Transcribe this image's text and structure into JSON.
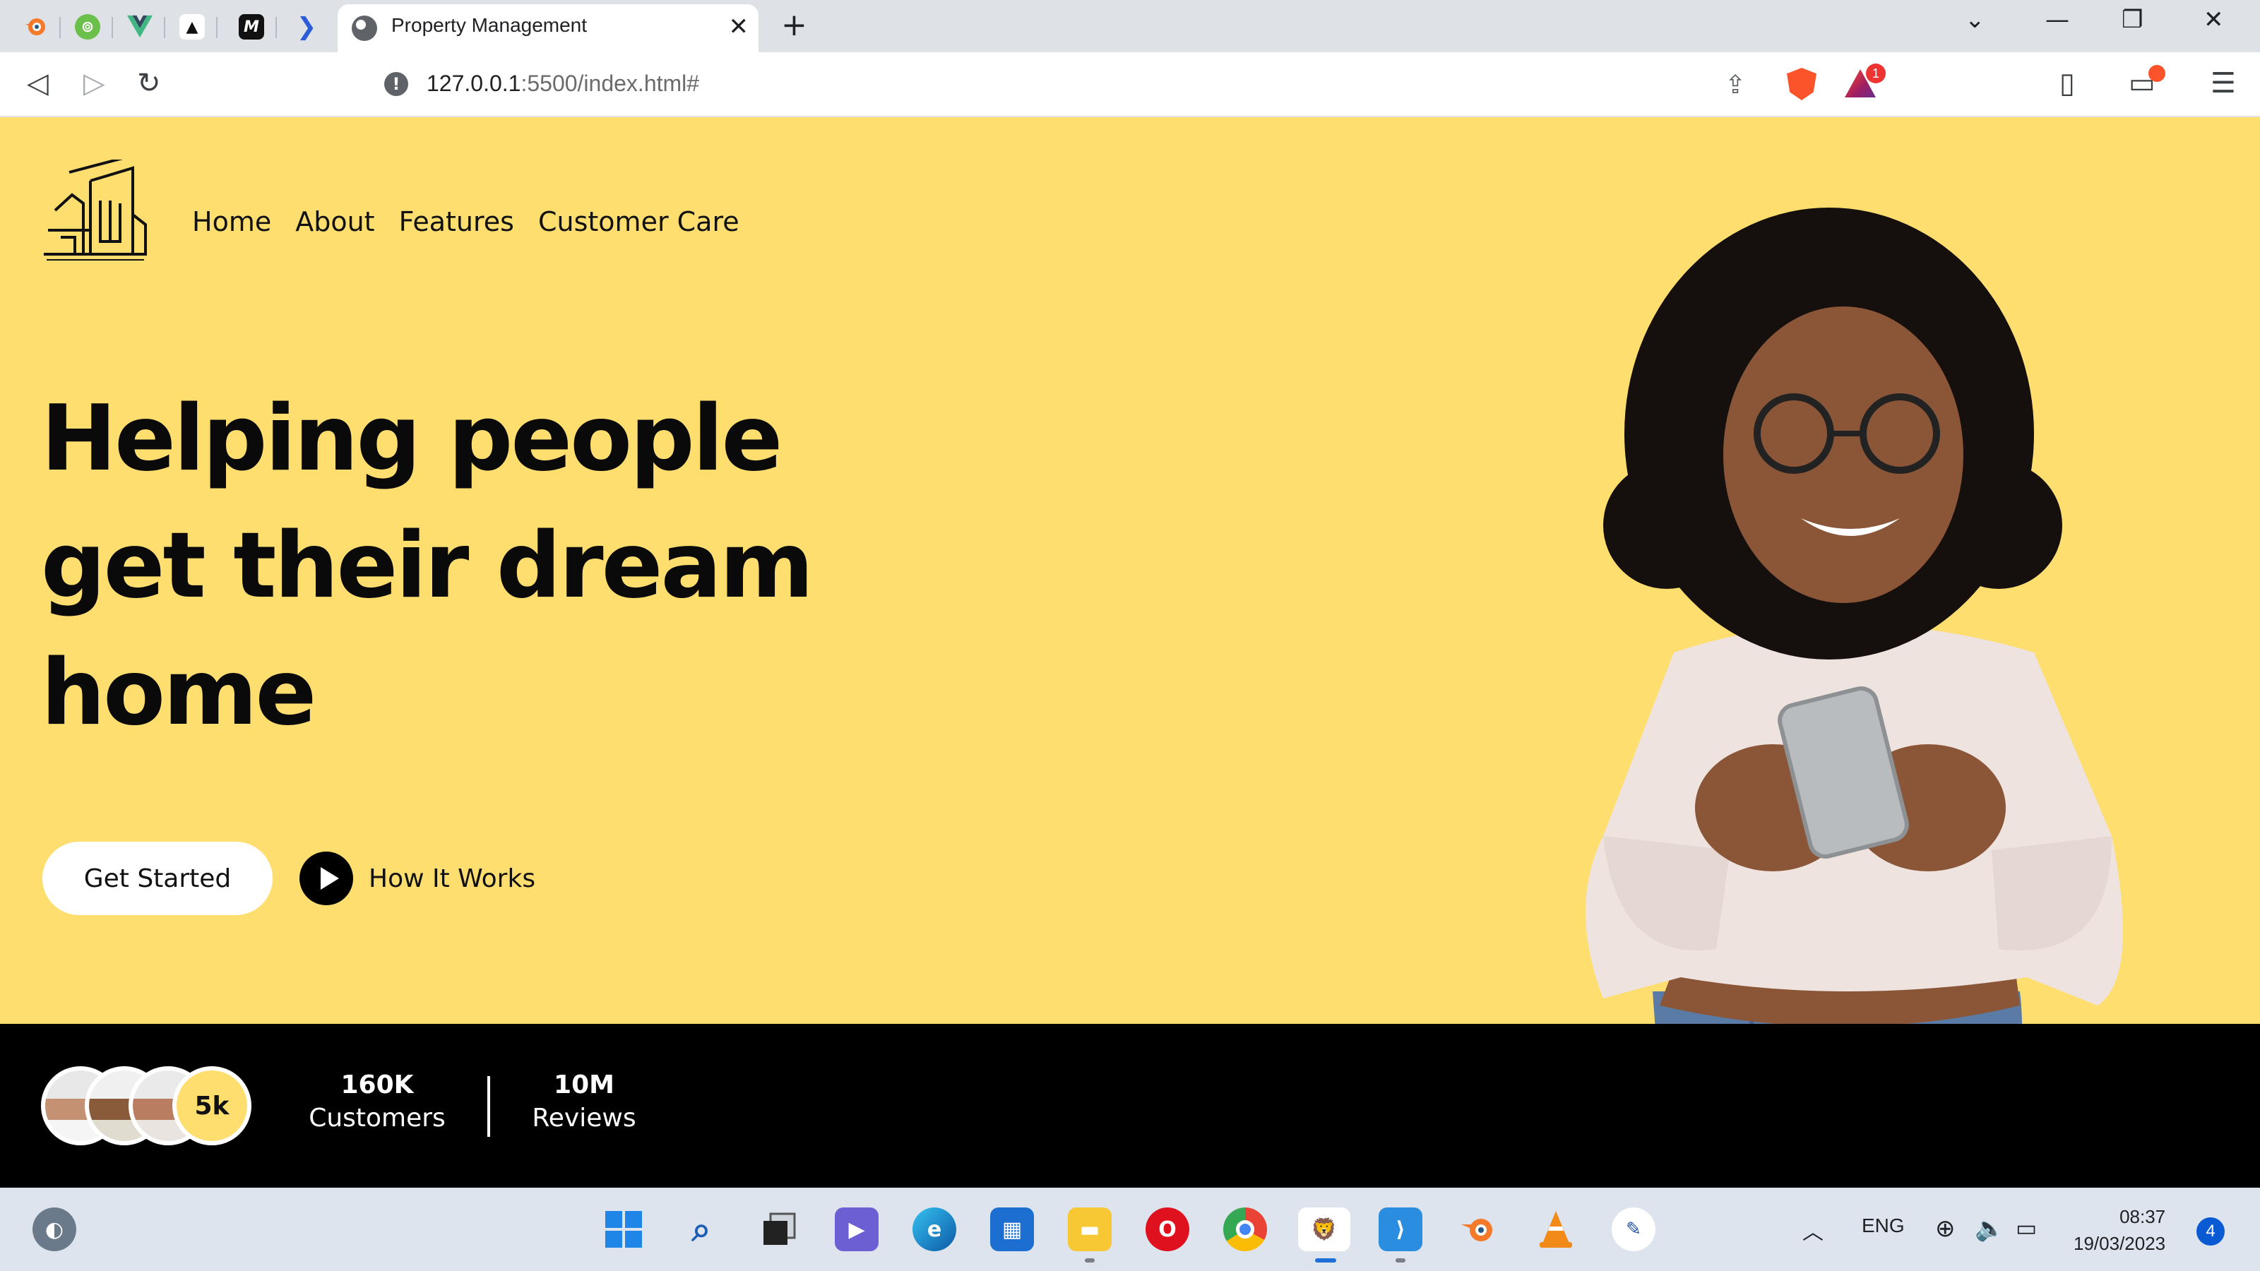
{
  "browser": {
    "pinned_tabs": [
      {
        "name": "blender",
        "color": "#f5792a"
      },
      {
        "name": "eng-circle",
        "color": "#6bbf4b"
      },
      {
        "name": "vue",
        "color": "#41b883"
      },
      {
        "name": "a-logo",
        "color": "#111111"
      },
      {
        "name": "m-logo",
        "color": "#111111"
      },
      {
        "name": "power-automate",
        "color": "#2b5dd6"
      }
    ],
    "active_tab": {
      "title": "Property Management",
      "close": "✕"
    },
    "new_tab": "+",
    "url_host": "127.0.0.1",
    "url_path": ":5500/index.html#",
    "rewards_badge": "1"
  },
  "page": {
    "nav": [
      "Home",
      "About",
      "Features",
      "Customer Care"
    ],
    "headline": "Helping people get their dream home",
    "buttons": {
      "get_started": "Get Started",
      "how_it_works": "How It Works"
    },
    "avatar_count": "5k",
    "stats": [
      {
        "value": "160K",
        "label": "Customers"
      },
      {
        "value": "10M",
        "label": "Reviews"
      }
    ],
    "colors": {
      "hero_bg": "#ffde70",
      "stats_bg": "#000000",
      "text": "#0a0a0a"
    }
  },
  "taskbar": {
    "apps": [
      "windows-start",
      "search",
      "task-view",
      "teams-chat",
      "edge",
      "microsoft-store",
      "file-explorer",
      "opera",
      "chrome",
      "brave",
      "vscode",
      "blender",
      "vlc",
      "notepad"
    ],
    "language": "ENG",
    "time": "08:37",
    "date": "19/03/2023",
    "notifications": "4"
  }
}
